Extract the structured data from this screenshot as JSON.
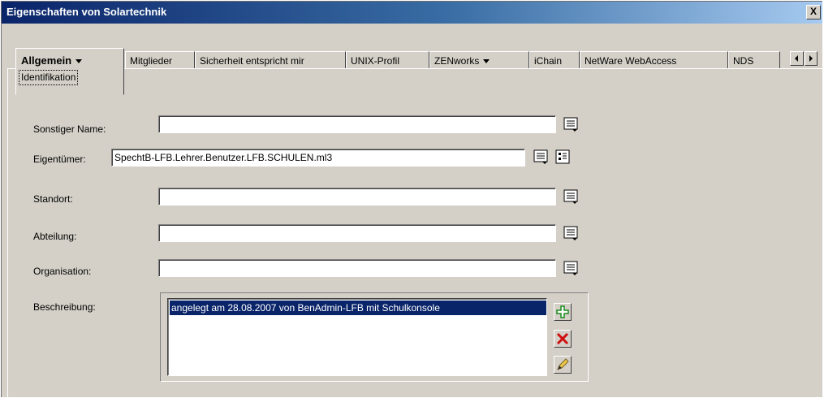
{
  "window": {
    "title": "Eigenschaften von Solartechnik",
    "close_label": "X"
  },
  "tabs": {
    "active": {
      "label": "Allgemein",
      "sub_label": "Identifikation"
    },
    "items": [
      {
        "label": "Mitglieder"
      },
      {
        "label": "Sicherheit entspricht mir"
      },
      {
        "label": "UNIX-Profil"
      },
      {
        "label": "ZENworks"
      },
      {
        "label": "iChain"
      },
      {
        "label": "NetWare WebAccess"
      },
      {
        "label": "NDS"
      }
    ]
  },
  "form": {
    "sonstiger_name": {
      "label": "Sonstiger Name:",
      "value": ""
    },
    "eigentuemer": {
      "label": "Eigentümer:",
      "value": "SpechtB-LFB.Lehrer.Benutzer.LFB.SCHULEN.ml3"
    },
    "standort": {
      "label": "Standort:",
      "value": ""
    },
    "abteilung": {
      "label": "Abteilung:",
      "value": ""
    },
    "organisation": {
      "label": "Organisation:",
      "value": ""
    },
    "beschreibung": {
      "label": "Beschreibung:",
      "items": [
        "angelegt am 28.08.2007 von BenAdmin-LFB mit Schulkonsole"
      ]
    }
  },
  "colors": {
    "selection": "#0a246a",
    "title_gradient_start": "#0a246a",
    "title_gradient_end": "#a6caf0",
    "face": "#d4d0c8"
  },
  "icons": {
    "multi_value": "edit-list-icon",
    "browse": "tree-browse-icon",
    "add": "plus-icon",
    "delete": "delete-x-icon",
    "edit": "pencil-icon"
  }
}
